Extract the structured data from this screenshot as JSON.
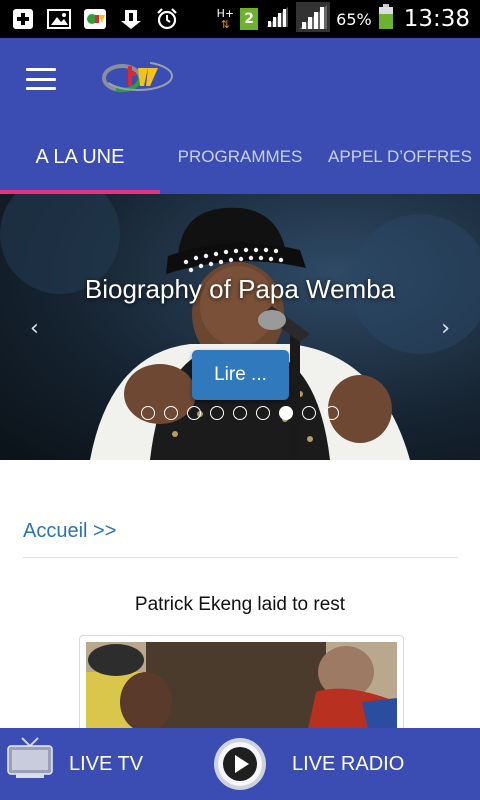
{
  "status_bar": {
    "network_type": "H+",
    "sim_slot": "2",
    "battery_percent": "65%",
    "time": "13:38",
    "icons": [
      "add-icon",
      "gallery-icon",
      "crtv-app-icon",
      "download-icon",
      "alarm-icon",
      "network-hplus-icon",
      "sim2-icon",
      "signal-icon",
      "signal-icon",
      "battery-icon"
    ]
  },
  "app_bar": {
    "menu_icon": "hamburger-menu-icon",
    "logo": "crtv-logo"
  },
  "tabs": [
    {
      "label": "A LA UNE",
      "active": true
    },
    {
      "label": "PROGRAMMES",
      "active": false
    },
    {
      "label": "APPEL D’OFFRES",
      "active": false
    }
  ],
  "carousel": {
    "title": "Biography of Papa Wemba",
    "button_label": "Lire ...",
    "prev_label": "‹",
    "next_label": "›",
    "slide_count": 9,
    "active_slide": 7
  },
  "content": {
    "breadcrumb": "Accueil >>",
    "article_title": "Patrick Ekeng laid to rest"
  },
  "bottom_bar": {
    "live_tv_label": "LIVE TV",
    "live_radio_label": "LIVE RADIO",
    "colors": {
      "bar": "#3b4db3",
      "accent": "#e5317e"
    }
  }
}
